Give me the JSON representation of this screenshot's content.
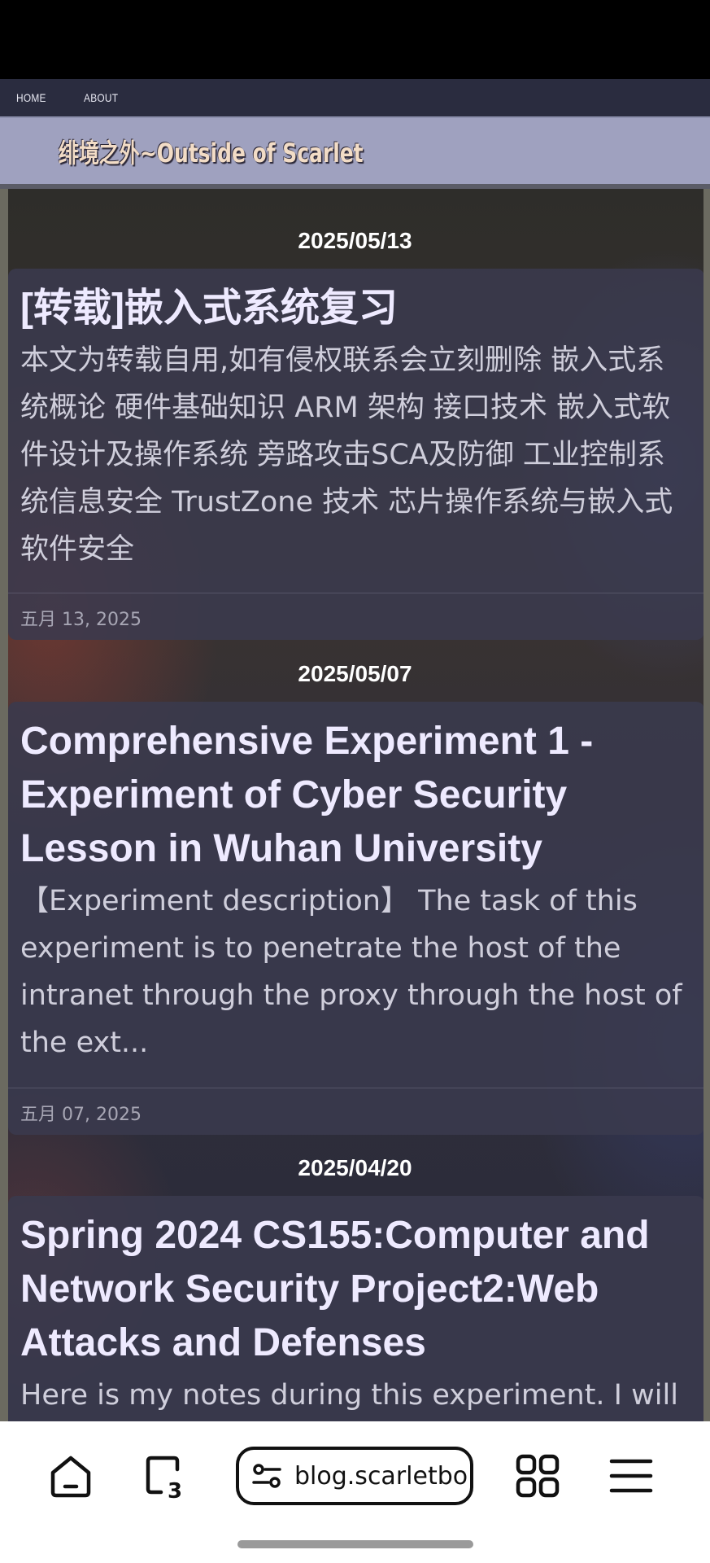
{
  "nav": {
    "home_label": "HOME",
    "about_label": "ABOUT"
  },
  "site": {
    "title": "绯境之外~Outside of Scarlet"
  },
  "posts": [
    {
      "date_heading": "2025/05/13",
      "title": "[转载]嵌入式系统复习",
      "excerpt": "本文为转载自用,如有侵权联系会立刻删除 嵌入式系统概论 硬件基础知识 ARM 架构 接口技术 嵌入式软件设计及操作系统 旁路攻击SCA及防御 工业控制系统信息安全 TrustZone 技术 芯片操作系统与嵌入式软件安全",
      "date": "五月 13, 2025"
    },
    {
      "date_heading": "2025/05/07",
      "title": "Comprehensive Experiment 1 - Experiment of Cyber Security Lesson in Wuhan University",
      "excerpt": "【Experiment description】 The task of this experiment is to penetrate the host of the intranet through the proxy through the host of the ext...",
      "date": "五月 07, 2025"
    },
    {
      "date_heading": "2025/04/20",
      "title": "Spring 2024 CS155:Computer and Network Security Project2:Web Attacks and Defenses",
      "excerpt": "Here is my notes during this experiment. I will"
    }
  ],
  "browser": {
    "url": "blog.scarletbo",
    "tab_count": "3",
    "icons": [
      "home-icon",
      "tabs-icon",
      "site-settings-icon",
      "apps-grid-icon",
      "menu-icon"
    ]
  }
}
